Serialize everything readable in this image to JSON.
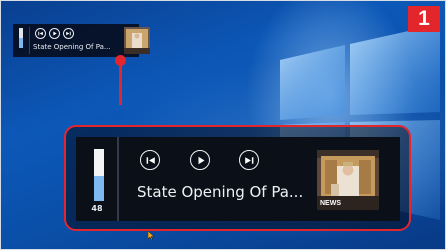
{
  "badge": "1",
  "mini_player": {
    "title": "State Opening Of Pa...",
    "volume_level": 0.5,
    "controls": [
      {
        "name": "previous",
        "icon": "skip-previous-icon"
      },
      {
        "name": "play",
        "icon": "play-icon"
      },
      {
        "name": "next",
        "icon": "skip-next-icon"
      }
    ]
  },
  "player": {
    "title": "State Opening Of Pa...",
    "volume": "48",
    "volume_level": 0.48,
    "controls": [
      {
        "name": "previous",
        "icon": "skip-previous-icon"
      },
      {
        "name": "play",
        "icon": "play-icon"
      },
      {
        "name": "next",
        "icon": "skip-next-icon"
      }
    ],
    "thumbnail_label": "NEWS"
  },
  "colors": {
    "accent": "#e3262c",
    "desktop": "#0c58b8",
    "volume_fill": "#7fb7ef",
    "panel": "#0b0f17"
  }
}
